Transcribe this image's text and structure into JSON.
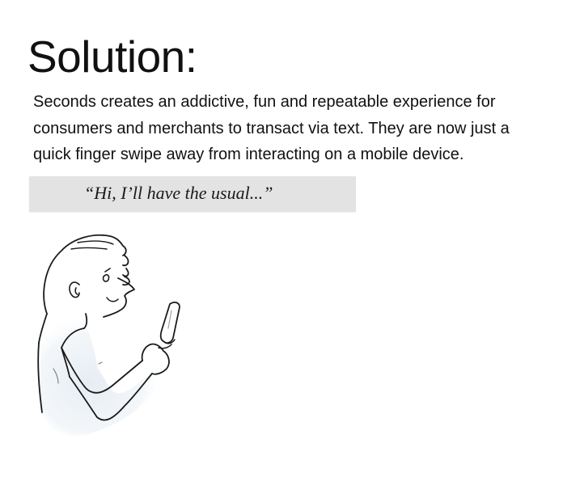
{
  "slide": {
    "title": "Solution:",
    "body_lines": [
      "Seconds creates an addictive, fun and repeatable experience for",
      "consumers and merchants to transact via text.  They are now just a",
      "quick finger swipe away from interacting on a mobile device."
    ],
    "quote": "“Hi, I’ll have the usual...”",
    "illustration": {
      "subject": "person-texting-on-phone",
      "icon": "person-with-phone-sketch-icon"
    }
  }
}
